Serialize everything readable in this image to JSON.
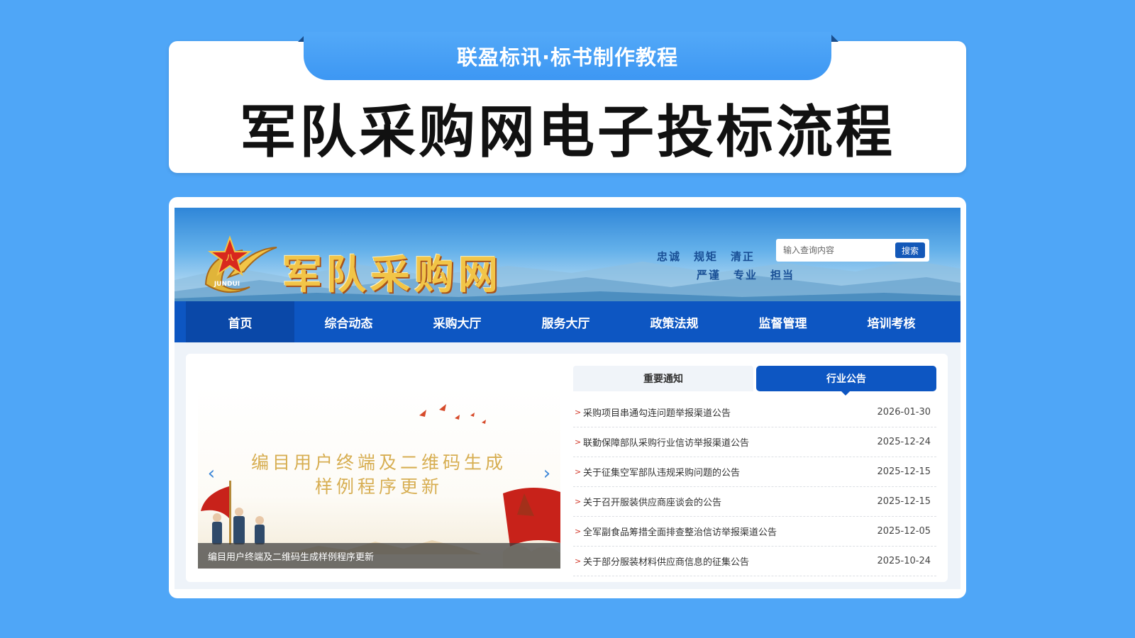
{
  "header": {
    "subtitle": "联盈标讯·标书制作教程",
    "title": "军队采购网电子投标流程"
  },
  "site": {
    "name": "军队采购网",
    "emblem_text": "JUNDUI",
    "slogan_line1": [
      "忠诚",
      "规矩",
      "清正"
    ],
    "slogan_line2": [
      "严谨",
      "专业",
      "担当"
    ],
    "search": {
      "placeholder": "输入查询内容",
      "button": "搜索"
    },
    "nav": [
      "首页",
      "综合动态",
      "采购大厅",
      "服务大厅",
      "政策法规",
      "监督管理",
      "培训考核"
    ],
    "nav_active": 0,
    "carousel": {
      "title_line1": "编目用户终端及二维码生成",
      "title_line2": "样例程序更新",
      "caption": "编目用户终端及二维码生成样例程序更新",
      "prev": "‹",
      "next": "›"
    },
    "tabs": [
      "重要通知",
      "行业公告"
    ],
    "tab_active": 1,
    "notices": [
      {
        "title": "采购项目串通勾连问题举报渠道公告",
        "date": "2026-01-30"
      },
      {
        "title": "联勤保障部队采购行业信访举报渠道公告",
        "date": "2025-12-24"
      },
      {
        "title": "关于征集空军部队违规采购问题的公告",
        "date": "2025-12-15"
      },
      {
        "title": "关于召开服装供应商座谈会的公告",
        "date": "2025-12-15"
      },
      {
        "title": "全军副食品筹措全面排查整治信访举报渠道公告",
        "date": "2025-12-05"
      },
      {
        "title": "关于部分服装材料供应商信息的征集公告",
        "date": "2025-10-24"
      }
    ],
    "bullet": ">",
    "colors": {
      "nav": "#0d56c2",
      "accent_gold": "#f2c548",
      "background": "#4fa6f7"
    }
  }
}
